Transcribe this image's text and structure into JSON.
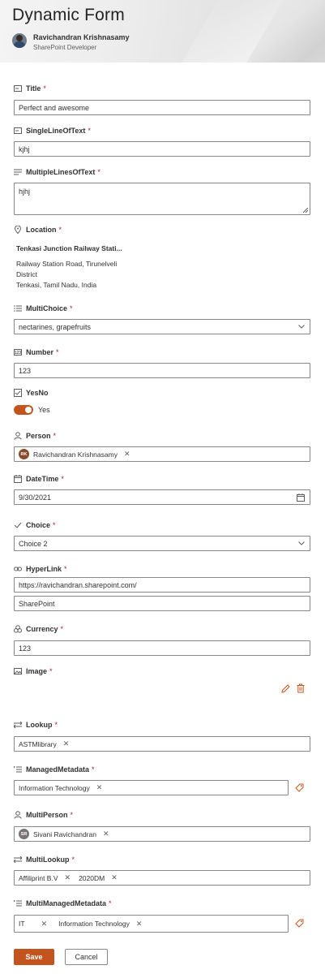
{
  "header": {
    "title": "Dynamic Form",
    "user_name": "Ravichandran Krishnasamy",
    "user_role": "SharePoint Developer"
  },
  "required_mark": "*",
  "fields": {
    "title": {
      "label": "Title",
      "value": "Perfect and awesome",
      "icon": "text-field-icon"
    },
    "single_line": {
      "label": "SingleLineOfText",
      "value": "kjhj",
      "icon": "text-field-icon"
    },
    "multi_lines": {
      "label": "MultipleLinesOfText",
      "value": "hjhj",
      "icon": "multiline-text-icon"
    },
    "location": {
      "label": "Location",
      "icon": "location-pin-icon",
      "name": "Tenkasi Junction Railway Stati...",
      "address_line1": "Railway Station Road, Tirunelveli",
      "address_line2": "District",
      "address_line3": "Tenkasi, Tamil Nadu, India"
    },
    "multi_choice": {
      "label": "MultiChoice",
      "value": "nectarines, grapefruits",
      "icon": "list-icon"
    },
    "number": {
      "label": "Number",
      "value": "123",
      "icon": "number-icon"
    },
    "yes_no": {
      "label": "YesNo",
      "state_text": "Yes",
      "on": true,
      "icon": "checkbox-icon"
    },
    "person": {
      "label": "Person",
      "icon": "person-icon",
      "initials": "RK",
      "name": "Ravichandran Krishnasamy",
      "avatar_color": "#8a4b2c"
    },
    "date_time": {
      "label": "DateTime",
      "value": "9/30/2021",
      "icon": "calendar-icon"
    },
    "choice": {
      "label": "Choice",
      "value": "Choice 2",
      "icon": "checkmark-icon"
    },
    "hyperlink": {
      "label": "HyperLink",
      "url": "https://ravichandran.sharepoint.com/",
      "text": "SharePoint",
      "icon": "link-icon"
    },
    "currency": {
      "label": "Currency",
      "value": "123",
      "icon": "currency-icon"
    },
    "image": {
      "label": "Image",
      "icon": "image-icon"
    },
    "lookup": {
      "label": "Lookup",
      "icon": "lookup-arrows-icon",
      "items": [
        "ASTMlibrary"
      ]
    },
    "managed_metadata": {
      "label": "ManagedMetadata",
      "icon": "taxonomy-icon",
      "items": [
        "Information Technology"
      ]
    },
    "multi_person": {
      "label": "MultiPerson",
      "icon": "person-icon",
      "initials": "SR",
      "name": "Sivani Ravichandran",
      "avatar_color": "#7a7574"
    },
    "multi_lookup": {
      "label": "MultiLookup",
      "icon": "lookup-arrows-icon",
      "items": [
        "Affiliprint B.V",
        "2020DM"
      ]
    },
    "multi_managed_metadata": {
      "label": "MultiManagedMetadata",
      "icon": "taxonomy-icon",
      "items": [
        "IT",
        "Information Technology"
      ]
    }
  },
  "actions": {
    "save_label": "Save",
    "cancel_label": "Cancel"
  },
  "colors": {
    "accent": "#c4541d",
    "required": "#a4262c",
    "border": "#8a8886"
  }
}
